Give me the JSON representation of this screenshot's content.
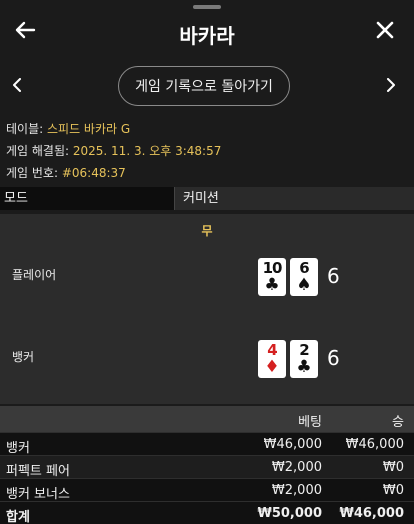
{
  "header": {
    "title": "바카라"
  },
  "nav": {
    "return_label": "게임 기록으로 돌아가기"
  },
  "info": {
    "table_label": "테이블: ",
    "table_value": "스피드 바카라 G",
    "settled_label": "게임 해결됨: ",
    "settled_value": "2025. 11. 3. 오후 3:48:57",
    "number_label": "게임 번호: ",
    "number_value": "#06:48:37"
  },
  "tabs": {
    "mode": "모드",
    "commission": "커미션"
  },
  "result": {
    "outcome": "무",
    "player": {
      "label": "플레이어",
      "score": "6",
      "cards": [
        {
          "rank": "10",
          "suit": "♣",
          "color": "black"
        },
        {
          "rank": "6",
          "suit": "♠",
          "color": "black"
        }
      ]
    },
    "banker": {
      "label": "뱅커",
      "score": "6",
      "cards": [
        {
          "rank": "4",
          "suit": "♦",
          "color": "red"
        },
        {
          "rank": "2",
          "suit": "♣",
          "color": "black"
        }
      ]
    }
  },
  "bets": {
    "header": {
      "bet": "베팅",
      "win": "승"
    },
    "rows": [
      {
        "name": "뱅커",
        "bet": "₩46,000",
        "win": "₩46,000"
      },
      {
        "name": "퍼펙트 페어",
        "bet": "₩2,000",
        "win": "₩0"
      },
      {
        "name": "뱅커 보너스",
        "bet": "₩2,000",
        "win": "₩0"
      }
    ],
    "total": {
      "name": "합계",
      "bet": "₩50,000",
      "win": "₩46,000"
    }
  },
  "colors": {
    "background": "#1b1b1b",
    "accent_gold": "#e6c25a",
    "red_suit": "#d42020"
  }
}
